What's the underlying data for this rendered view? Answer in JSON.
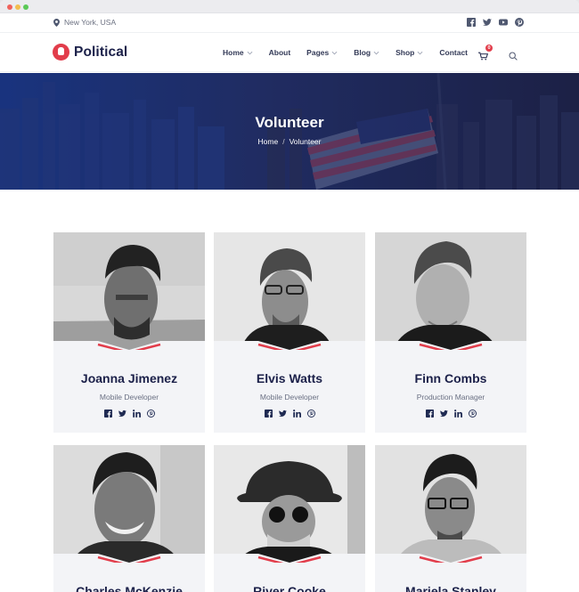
{
  "topbar": {
    "location": "New York, USA",
    "socials": [
      "facebook-icon",
      "twitter-icon",
      "youtube-icon",
      "pinterest-icon"
    ]
  },
  "brand": {
    "name": "Political",
    "accent": "#e23d4b",
    "navy": "#1b2049"
  },
  "nav": {
    "items": [
      {
        "label": "Home",
        "dropdown": true
      },
      {
        "label": "About",
        "dropdown": false
      },
      {
        "label": "Pages",
        "dropdown": true
      },
      {
        "label": "Blog",
        "dropdown": true
      },
      {
        "label": "Shop",
        "dropdown": true
      },
      {
        "label": "Contact",
        "dropdown": false
      }
    ],
    "cart_count": "0"
  },
  "hero": {
    "title": "Volunteer",
    "breadcrumb_home": "Home",
    "breadcrumb_sep": "/",
    "breadcrumb_current": "Volunteer"
  },
  "volunteers": [
    {
      "name": "Joanna Jimenez",
      "role": "Mobile Developer"
    },
    {
      "name": "Elvis Watts",
      "role": "Mobile Developer"
    },
    {
      "name": "Finn Combs",
      "role": "Production Manager"
    },
    {
      "name": "Charles McKenzie",
      "role": ""
    },
    {
      "name": "River Cooke",
      "role": ""
    },
    {
      "name": "Mariela Stanley",
      "role": ""
    }
  ]
}
